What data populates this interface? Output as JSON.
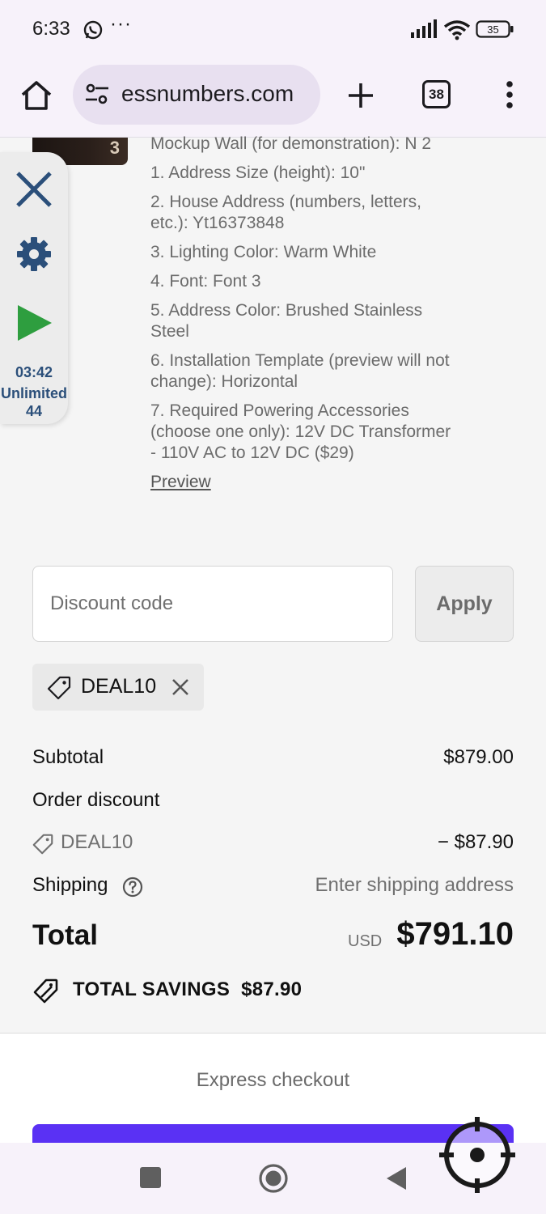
{
  "status": {
    "time": "6:33",
    "more": "···",
    "battery": "35"
  },
  "browser": {
    "url": "essnumbers.com",
    "tab_count": "38"
  },
  "product": {
    "thumb_digit": "3",
    "details": [
      "Mockup Wall (for demonstration): N 2",
      "1. Address Size (height): 10\"",
      "2. House Address (numbers, letters, etc.): Yt16373848",
      "3. Lighting Color: Warm White",
      "4. Font: Font 3",
      "5. Address Color: Brushed Stainless Steel",
      "6. Installation Template (preview will not change): Horizontal",
      "7. Required Powering Accessories (choose one only): 12V DC Transformer - 110V AC to 12V DC ($29)"
    ],
    "preview_label": "Preview"
  },
  "recorder": {
    "time": "03:42",
    "mode": "Unlimited",
    "count": "44"
  },
  "discount": {
    "placeholder": "Discount code",
    "apply_label": "Apply",
    "applied_code": "DEAL10"
  },
  "summary": {
    "subtotal_label": "Subtotal",
    "subtotal_value": "$879.00",
    "order_discount_label": "Order discount",
    "discount_code": "DEAL10",
    "discount_value": "− $87.90",
    "shipping_label": "Shipping",
    "shipping_value": "Enter shipping address",
    "total_label": "Total",
    "currency": "USD",
    "total_value": "$791.10",
    "savings_label": "TOTAL SAVINGS",
    "savings_value": "$87.90"
  },
  "express": {
    "title": "Express checkout"
  },
  "colors": {
    "accent": "#5a31f4",
    "recorder_blue": "#2b4f7a",
    "play_green": "#2e9e3f"
  }
}
